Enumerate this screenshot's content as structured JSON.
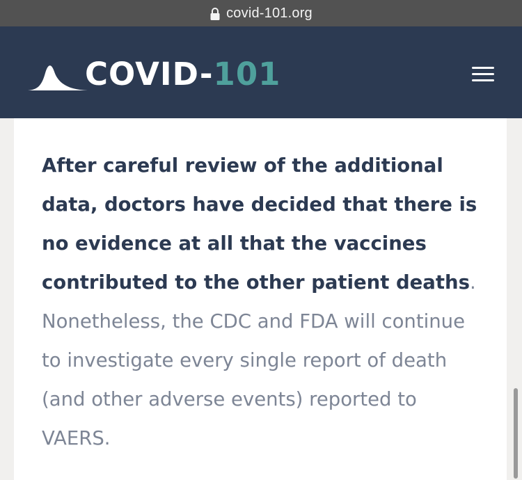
{
  "browser": {
    "url": "covid-101.org",
    "lock_icon": "lock-icon"
  },
  "header": {
    "logo_word": "COVID-",
    "logo_number": "101",
    "logo_icon": "bell-curve-icon",
    "menu_icon": "hamburger-menu-icon",
    "background_color": "#2c3a52",
    "accent_color": "#4fa09c"
  },
  "article": {
    "bold_text": "After careful review of the additional data, doctors have decided that there is no evidence at all that the vaccines contributed to the other patient deaths",
    "period": ".",
    "regular_text": " Nonetheless, the CDC and FDA will continue to investigate every single report of death (and other adverse events) reported to VAERS.",
    "text_color": "#7d8595",
    "bold_color": "#2c3a52"
  }
}
